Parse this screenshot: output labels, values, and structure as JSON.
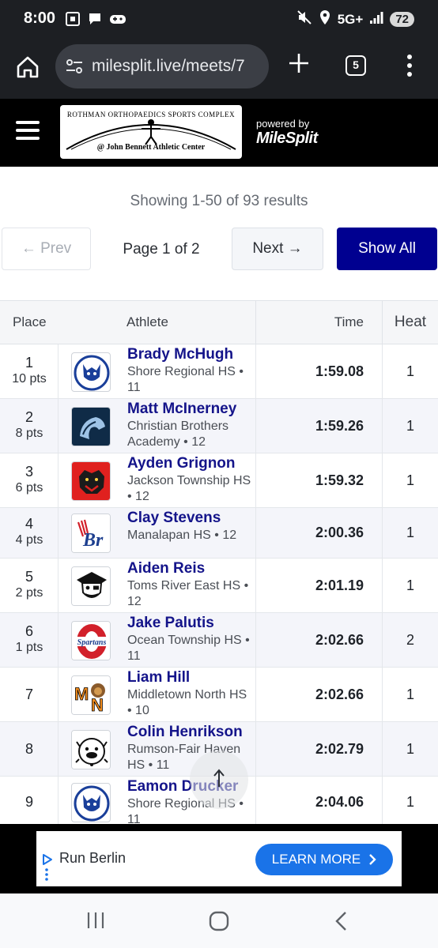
{
  "status_bar": {
    "time": "8:00",
    "network": "5G+",
    "battery": "72"
  },
  "browser": {
    "url": "milesplit.live/meets/7",
    "tab_count": "5"
  },
  "site_header": {
    "logo_top_text": "ROTHMAN ORTHOPAEDICS SPORTS COMPLEX",
    "logo_bottom_text": "@ John Bennett Athletic Center",
    "powered_by_label": "powered by",
    "powered_by_brand": "MileSplit"
  },
  "results": {
    "summary": "Showing 1-50 of 93 results",
    "prev_label": "← Prev",
    "page_label": "Page 1 of 2",
    "next_label": "Next →",
    "show_all_label": "Show All"
  },
  "table": {
    "headers": {
      "place": "Place",
      "athlete": "Athlete",
      "time": "Time",
      "heat": "Heat"
    },
    "rows": [
      {
        "place": "1",
        "pts": "10 pts",
        "name": "Brady McHugh",
        "school": "Shore Regional HS • 11",
        "time": "1:59.08",
        "heat": "1",
        "logo": "shore-regional-logo"
      },
      {
        "place": "2",
        "pts": "8 pts",
        "name": "Matt McInerney",
        "school": "Christian Brothers Academy • 12",
        "time": "1:59.26",
        "heat": "1",
        "logo": "cba-colt-logo"
      },
      {
        "place": "3",
        "pts": "6 pts",
        "name": "Ayden Grignon",
        "school": "Jackson Township HS • 12",
        "time": "1:59.32",
        "heat": "1",
        "logo": "jackson-jaguar-logo"
      },
      {
        "place": "4",
        "pts": "4 pts",
        "name": "Clay Stevens",
        "school": "Manalapan HS • 12",
        "time": "2:00.36",
        "heat": "1",
        "logo": "manalapan-braves-logo"
      },
      {
        "place": "5",
        "pts": "2 pts",
        "name": "Aiden Reis",
        "school": "Toms River East HS • 12",
        "time": "2:01.19",
        "heat": "1",
        "logo": "toms-river-east-pirate-logo"
      },
      {
        "place": "6",
        "pts": "1 pts",
        "name": "Jake Palutis",
        "school": "Ocean Township HS • 11",
        "time": "2:02.66",
        "heat": "2",
        "logo": "ocean-spartans-logo"
      },
      {
        "place": "7",
        "pts": "",
        "name": "Liam Hill",
        "school": "Middletown North HS • 10",
        "time": "2:02.66",
        "heat": "1",
        "logo": "middletown-north-lion-logo"
      },
      {
        "place": "8",
        "pts": "",
        "name": "Colin Henrikson",
        "school": "Rumson-Fair Haven HS • 11",
        "time": "2:02.79",
        "heat": "1",
        "logo": "rumson-bulldog-logo"
      },
      {
        "place": "9",
        "pts": "",
        "name": "Eamon Drucker",
        "school": "Shore Regional HS • 11",
        "time": "2:04.06",
        "heat": "1",
        "logo": "shore-regional-logo"
      }
    ]
  },
  "ad": {
    "title": "Run Berlin",
    "cta": "LEARN MORE"
  },
  "colors": {
    "accent": "#000090",
    "link": "#14148a",
    "ad_button": "#1a73e8"
  }
}
